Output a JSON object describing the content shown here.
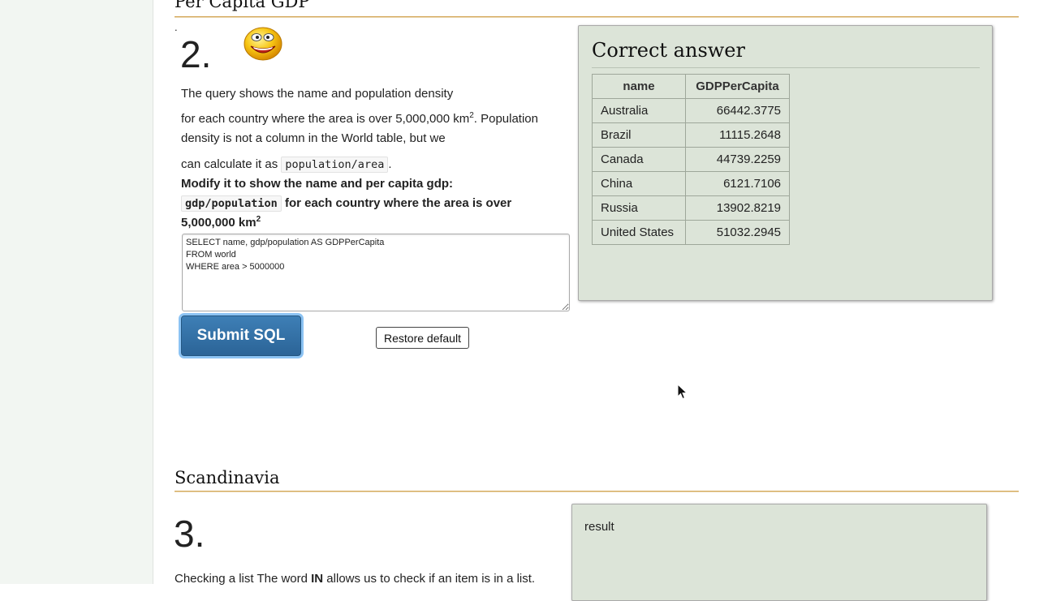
{
  "sidebar": {},
  "section_prev": {
    "title": "Per Capita GDP"
  },
  "question2": {
    "dot": ".",
    "number": "2.",
    "text_line1": "The query shows the name and population density",
    "text_line2_a": "for each country where the area is over 5,000,000 km",
    "sup2": "2",
    "text_line2_b": ". Population density is not a column in the World table, but we",
    "text_line3_a": "can calculate it as ",
    "code1": "population/area",
    "text_line3_b": ".",
    "bold_line1": "Modify it to show the name and per capita gdp:",
    "code2": "gdp/population",
    "bold_line2_b": " for each country where the area is over",
    "bold_line3": "5,000,000 km",
    "sql": "SELECT name, gdp/population AS GDPPerCapita\nFROM world\nWHERE area > 5000000",
    "submit_label": "Submit SQL",
    "restore_label": "Restore default"
  },
  "answer": {
    "title": "Correct answer",
    "headers": [
      "name",
      "GDPPerCapita"
    ],
    "rows": [
      [
        "Australia",
        "66442.3775"
      ],
      [
        "Brazil",
        "11115.2648"
      ],
      [
        "Canada",
        "44739.2259"
      ],
      [
        "China",
        "6121.7106"
      ],
      [
        "Russia",
        "13902.8219"
      ],
      [
        "United States",
        "51032.2945"
      ]
    ]
  },
  "section_next": {
    "title": "Scandinavia"
  },
  "question3": {
    "number": "3.",
    "text_a": "Checking a list The word ",
    "text_bold": "IN",
    "text_b": " allows us to check if an item is in a list.",
    "result_label": "result"
  },
  "icons": {
    "smiley": "smiley-face-icon",
    "cursor": "mouse-pointer-icon"
  },
  "colors": {
    "accent_rule": "#d4a85a",
    "panel_bg": "#dce4d8",
    "submit_bg": "#2b6497"
  }
}
